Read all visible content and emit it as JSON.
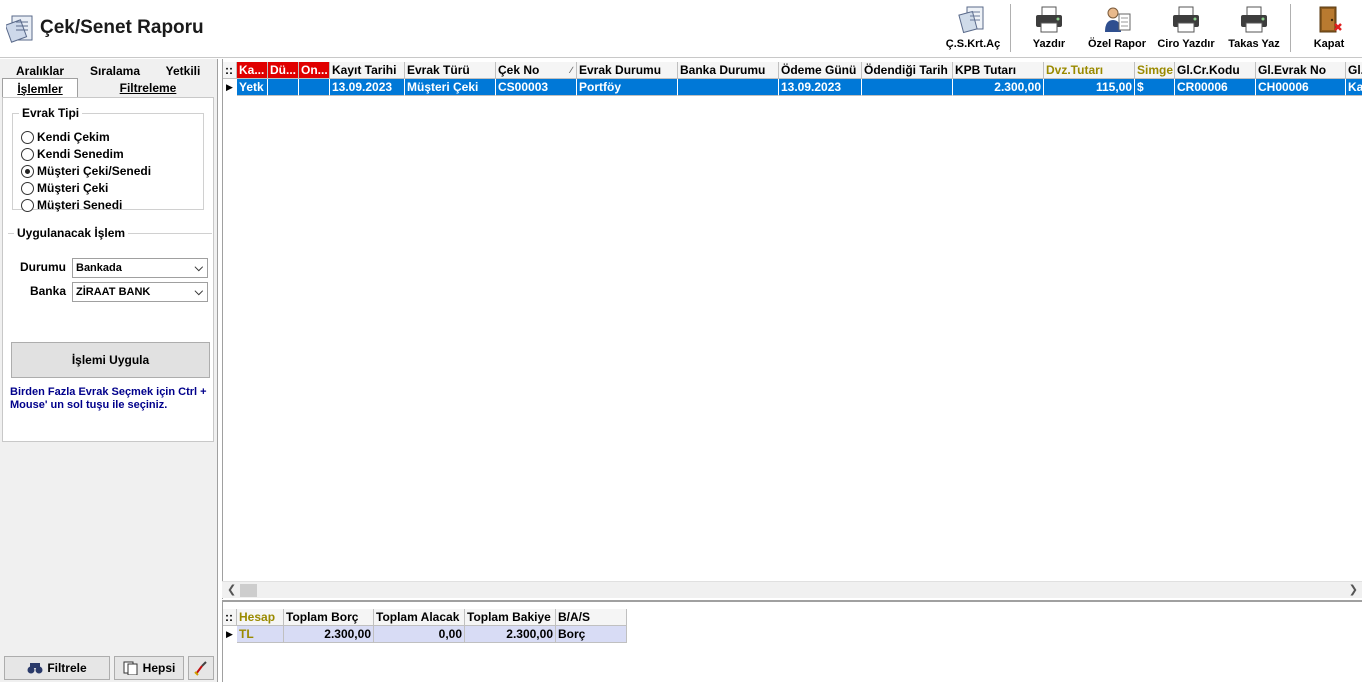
{
  "window": {
    "title": "Çek/Senet Raporu"
  },
  "toolbar": [
    {
      "id": "cs",
      "label": "Ç.S.Krt.Aç",
      "icon": "card-open-icon"
    },
    {
      "id": "print",
      "label": "Yazdır",
      "icon": "printer-icon"
    },
    {
      "id": "custom",
      "label": "Özel Rapor",
      "icon": "users-report-icon"
    },
    {
      "id": "ciro",
      "label": "Ciro Yazdır",
      "icon": "printer-icon"
    },
    {
      "id": "takas",
      "label": "Takas Yaz",
      "icon": "printer-icon"
    },
    {
      "id": "close",
      "label": "Kapat",
      "icon": "exit-door-icon"
    }
  ],
  "left_tabs": {
    "row1": [
      "Aralıklar",
      "Sıralama",
      "Yetkili"
    ],
    "row2": [
      "İşlemler",
      "Filtreleme"
    ],
    "active": "İşlemler"
  },
  "evrak_tipi": {
    "legend": "Evrak Tipi",
    "options": [
      "Kendi Çekim",
      "Kendi Senedim",
      "Müşteri Çeki/Senedi",
      "Müşteri Çeki",
      "Müşteri Senedi"
    ],
    "selected_index": 2
  },
  "uygulanacak": {
    "legend": "Uygulanacak İşlem",
    "durum_label": "Durumu",
    "durum_value": "Bankada",
    "banka_label": "Banka",
    "banka_value": "ZİRAAT BANK",
    "apply_label": "İşlemi Uygula",
    "hint": "Birden Fazla Evrak Seçmek için Ctrl + Mouse' un sol tuşu ile seçiniz."
  },
  "bottom_buttons": {
    "filter": "Filtrele",
    "all": "Hepsi"
  },
  "grid": {
    "columns": [
      "Ka...",
      "Dü...",
      "On...",
      "Kayıt Tarihi",
      "Evrak Türü",
      "Çek No",
      "Evrak Durumu",
      "Banka Durumu",
      "Ödeme Günü",
      "Ödendiği Tarih",
      "KPB Tutarı",
      "Dvz.Tutarı",
      "Simge",
      "Gl.Cr.Kodu",
      "Gl.Evrak No",
      "Gl."
    ],
    "rows": [
      [
        "Yetk",
        "",
        "",
        "13.09.2023",
        "Müşteri Çeki",
        "CS00003",
        "Portföy",
        "",
        "13.09.2023",
        "",
        "2.300,00",
        "115,00",
        "$",
        "CR00006",
        "CH00006",
        "Ka"
      ]
    ]
  },
  "summary": {
    "columns": [
      "Hesap",
      "Toplam Borç",
      "Toplam Alacak",
      "Toplam Bakiye",
      "B/A/S"
    ],
    "rows": [
      [
        "TL",
        "2.300,00",
        "0,00",
        "2.300,00",
        "Borç"
      ]
    ]
  },
  "colors": {
    "selection": "#0078d7",
    "header_red": "#e00000",
    "summary_row": "#d8dcf5",
    "olive": "#9a8a00"
  }
}
